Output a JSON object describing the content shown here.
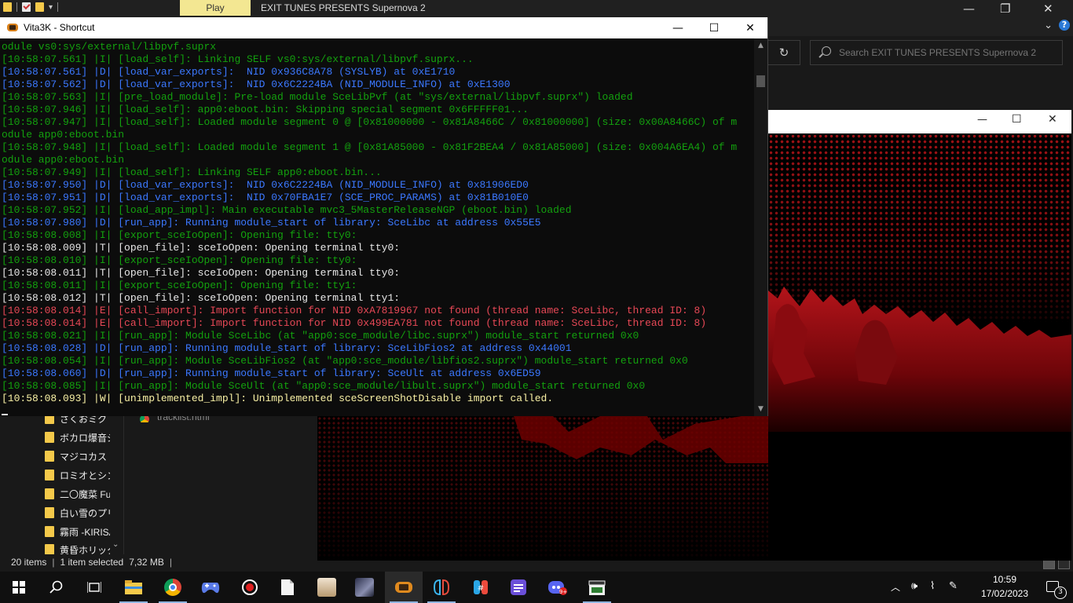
{
  "explorer": {
    "ribbon_tab": "Play",
    "title": "EXIT TUNES PRESENTS Supernova 2",
    "search_placeholder": "Search EXIT TUNES PRESENTS Supernova 2",
    "nav_items": [
      "さくおミク",
      "ボカロ爆音ジ",
      "マジコカスト",
      "ロミオとシンデ",
      "二〇魔菜 Fu",
      "白い雪のプリ",
      "霧雨 -KIRISA",
      "黄昏ホリック"
    ],
    "partial_file": "tracklist.html",
    "status": {
      "items": "20 items",
      "selected": "1 item selected",
      "size": "7,32 MB"
    }
  },
  "console": {
    "title": "Vita3K - Shortcut",
    "lines": [
      {
        "level": "I",
        "text": "odule vs0:sys/external/libpvf.suprx"
      },
      {
        "level": "I",
        "text": "[10:58:07.561] |I| [load_self]: Linking SELF vs0:sys/external/libpvf.suprx..."
      },
      {
        "level": "D",
        "text": "[10:58:07.561] |D| [load_var_exports]:  NID 0x936C8A78 (SYSLYB) at 0xE1710"
      },
      {
        "level": "D",
        "text": "[10:58:07.562] |D| [load_var_exports]:  NID 0x6C2224BA (NID_MODULE_INFO) at 0xE1300"
      },
      {
        "level": "I",
        "text": "[10:58:07.563] |I| [pre_load_module]: Pre-load module SceLibPvf (at \"sys/external/libpvf.suprx\") loaded"
      },
      {
        "level": "I",
        "text": "[10:58:07.946] |I| [load_self]: app0:eboot.bin: Skipping special segment 0x6FFFFF01..."
      },
      {
        "level": "I",
        "text": "[10:58:07.947] |I| [load_self]: Loaded module segment 0 @ [0x81000000 - 0x81A8466C / 0x81000000] (size: 0x00A8466C) of m"
      },
      {
        "level": "I",
        "text": "odule app0:eboot.bin"
      },
      {
        "level": "I",
        "text": "[10:58:07.948] |I| [load_self]: Loaded module segment 1 @ [0x81A85000 - 0x81F2BEA4 / 0x81A85000] (size: 0x004A6EA4) of m"
      },
      {
        "level": "I",
        "text": "odule app0:eboot.bin"
      },
      {
        "level": "I",
        "text": "[10:58:07.949] |I| [load_self]: Linking SELF app0:eboot.bin..."
      },
      {
        "level": "D",
        "text": "[10:58:07.950] |D| [load_var_exports]:  NID 0x6C2224BA (NID_MODULE_INFO) at 0x81906ED0"
      },
      {
        "level": "D",
        "text": "[10:58:07.951] |D| [load_var_exports]:  NID 0x70FBA1E7 (SCE_PROC_PARAMS) at 0x81B010E0"
      },
      {
        "level": "I",
        "text": "[10:58:07.952] |I| [load_app_impl]: Main executable mvc3_5MasterReleaseNGP (eboot.bin) loaded"
      },
      {
        "level": "D",
        "text": "[10:58:07.980] |D| [run_app]: Running module_start of library: SceLibc at address 0x55E5"
      },
      {
        "level": "I",
        "text": "[10:58:08.008] |I| [export_sceIoOpen]: Opening file: tty0:"
      },
      {
        "level": "T",
        "text": "[10:58:08.009] |T| [open_file]: sceIoOpen: Opening terminal tty0:"
      },
      {
        "level": "I",
        "text": "[10:58:08.010] |I| [export_sceIoOpen]: Opening file: tty0:"
      },
      {
        "level": "T",
        "text": "[10:58:08.011] |T| [open_file]: sceIoOpen: Opening terminal tty0:"
      },
      {
        "level": "I",
        "text": "[10:58:08.011] |I| [export_sceIoOpen]: Opening file: tty1:"
      },
      {
        "level": "T",
        "text": "[10:58:08.012] |T| [open_file]: sceIoOpen: Opening terminal tty1:"
      },
      {
        "level": "E",
        "text": "[10:58:08.014] |E| [call_import]: Import function for NID 0xA7819967 not found (thread name: SceLibc, thread ID: 8)"
      },
      {
        "level": "E",
        "text": "[10:58:08.014] |E| [call_import]: Import function for NID 0x499EA781 not found (thread name: SceLibc, thread ID: 8)"
      },
      {
        "level": "I",
        "text": "[10:58:08.021] |I| [run_app]: Module SceLibc (at \"app0:sce_module/libc.suprx\") module_start returned 0x0"
      },
      {
        "level": "D",
        "text": "[10:58:08.028] |D| [run_app]: Running module_start of library: SceLibFios2 at address 0x44001"
      },
      {
        "level": "I",
        "text": "[10:58:08.054] |I| [run_app]: Module SceLibFios2 (at \"app0:sce_module/libfios2.suprx\") module_start returned 0x0"
      },
      {
        "level": "D",
        "text": "[10:58:08.060] |D| [run_app]: Running module_start of library: SceUlt at address 0x6ED59"
      },
      {
        "level": "I",
        "text": "[10:58:08.085] |I| [run_app]: Module SceUlt (at \"app0:sce_module/libult.suprx\") module_start returned 0x0"
      },
      {
        "level": "W",
        "text": "[10:58:08.093] |W| [unimplemented_impl]: Unimplemented sceScreenShotDisable import called."
      }
    ]
  },
  "taskbar": {
    "time": "10:59",
    "date": "17/02/2023",
    "notification_count": "3",
    "apps": [
      "start",
      "search",
      "task-view",
      "file-explorer",
      "chrome",
      "gamepad",
      "obs",
      "notepad",
      "anime-avatar",
      "game-art",
      "vita3k",
      "switch-emulator",
      "switch-controller",
      "tile-app",
      "discord",
      "clapper"
    ]
  },
  "colors": {
    "info": "#13a10e",
    "debug": "#3b78ff",
    "trace": "#e8e8e8",
    "error": "#e74856",
    "warn": "#f9f1a5",
    "play_tab": "#f3e792"
  }
}
